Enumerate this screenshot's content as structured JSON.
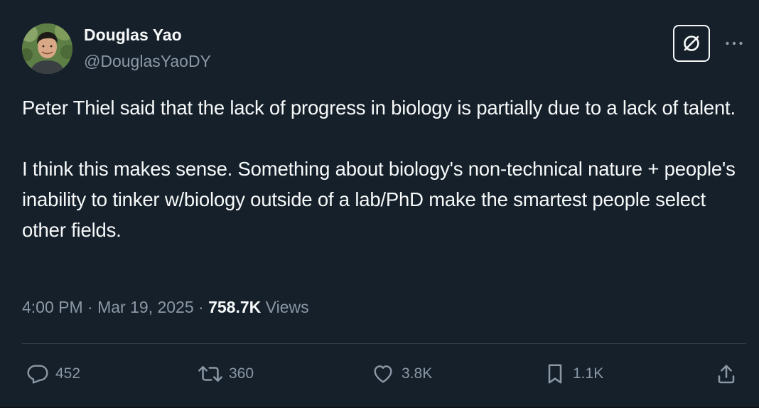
{
  "author": {
    "name": "Douglas Yao",
    "handle": "@DouglasYaoDY",
    "avatar_icon": "profile-photo"
  },
  "tweet": {
    "text": "Peter Thiel said that the lack of progress in biology is partially due to a lack of talent.\n\nI think this makes sense. Something about biology's non-technical nature + people's inability to tinker w/biology outside of a lab/PhD make the smartest people select other fields.",
    "time": "4:00 PM",
    "separator1": " · ",
    "date": "Mar 19, 2025",
    "separator2": " · ",
    "views_count": "758.7K",
    "views_label": " Views"
  },
  "actions": {
    "reply": {
      "icon": "reply-icon",
      "count": "452"
    },
    "retweet": {
      "icon": "retweet-icon",
      "count": "360"
    },
    "like": {
      "icon": "heart-icon",
      "count": "3.8K"
    },
    "bookmark": {
      "icon": "bookmark-icon",
      "count": "1.1K"
    },
    "share": {
      "icon": "share-icon"
    }
  },
  "header_buttons": {
    "grok": {
      "icon": "grok-icon"
    },
    "more": {
      "icon": "more-icon"
    }
  },
  "colors": {
    "background": "#15202b",
    "text_primary": "#f7f9f9",
    "text_secondary": "#8b98a5",
    "divider": "#38444d"
  }
}
